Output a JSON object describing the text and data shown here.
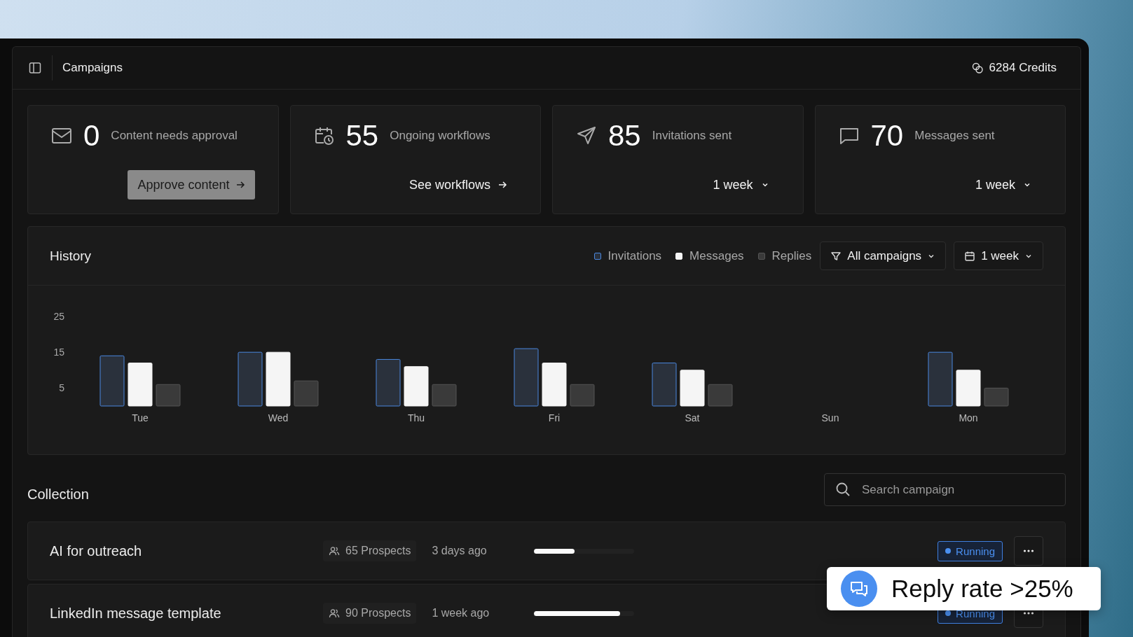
{
  "header": {
    "title": "Campaigns",
    "credits": "6284 Credits"
  },
  "stats": [
    {
      "value": "0",
      "label": "Content needs approval",
      "action": {
        "kind": "button",
        "label": "Approve content"
      }
    },
    {
      "value": "55",
      "label": "Ongoing workflows",
      "action": {
        "kind": "link",
        "label": "See workflows"
      }
    },
    {
      "value": "85",
      "label": "Invitations sent",
      "action": {
        "kind": "dropdown",
        "label": "1 week"
      }
    },
    {
      "value": "70",
      "label": "Messages sent",
      "action": {
        "kind": "dropdown",
        "label": "1 week"
      }
    }
  ],
  "history": {
    "title": "History",
    "filters": [
      {
        "kind": "filter",
        "label": "All campaigns"
      },
      {
        "kind": "date",
        "label": "1 week"
      }
    ],
    "chart_data": {
      "type": "bar",
      "categories": [
        "Tue",
        "Wed",
        "Thu",
        "Fri",
        "Sat",
        "Sun",
        "Mon"
      ],
      "ylim": [
        0,
        25
      ],
      "yticks": [
        5,
        15,
        25
      ],
      "series": [
        {
          "name": "Invitations",
          "color": "#4a88e0",
          "values": [
            14,
            15,
            13,
            16,
            12,
            null,
            15
          ]
        },
        {
          "name": "Messages",
          "color": "#f5f5f5",
          "values": [
            12,
            15,
            11,
            12,
            10,
            null,
            10
          ]
        },
        {
          "name": "Replies",
          "color": "#3a3a3a",
          "values": [
            6,
            7,
            6,
            6,
            6,
            null,
            5
          ]
        }
      ]
    }
  },
  "collection": {
    "title": "Collection",
    "search": {
      "placeholder": "Search campaign"
    },
    "rows": [
      {
        "name": "AI for outreach",
        "prospects": "65 Prospects",
        "updated": "3 days ago",
        "level": 0.4,
        "status": "Running"
      },
      {
        "name": "LinkedIn message template",
        "prospects": "90 Prospects",
        "updated": "1 week ago",
        "level": 0.86,
        "status": "Running"
      }
    ]
  },
  "toast": {
    "text": "Reply rate >25%"
  }
}
